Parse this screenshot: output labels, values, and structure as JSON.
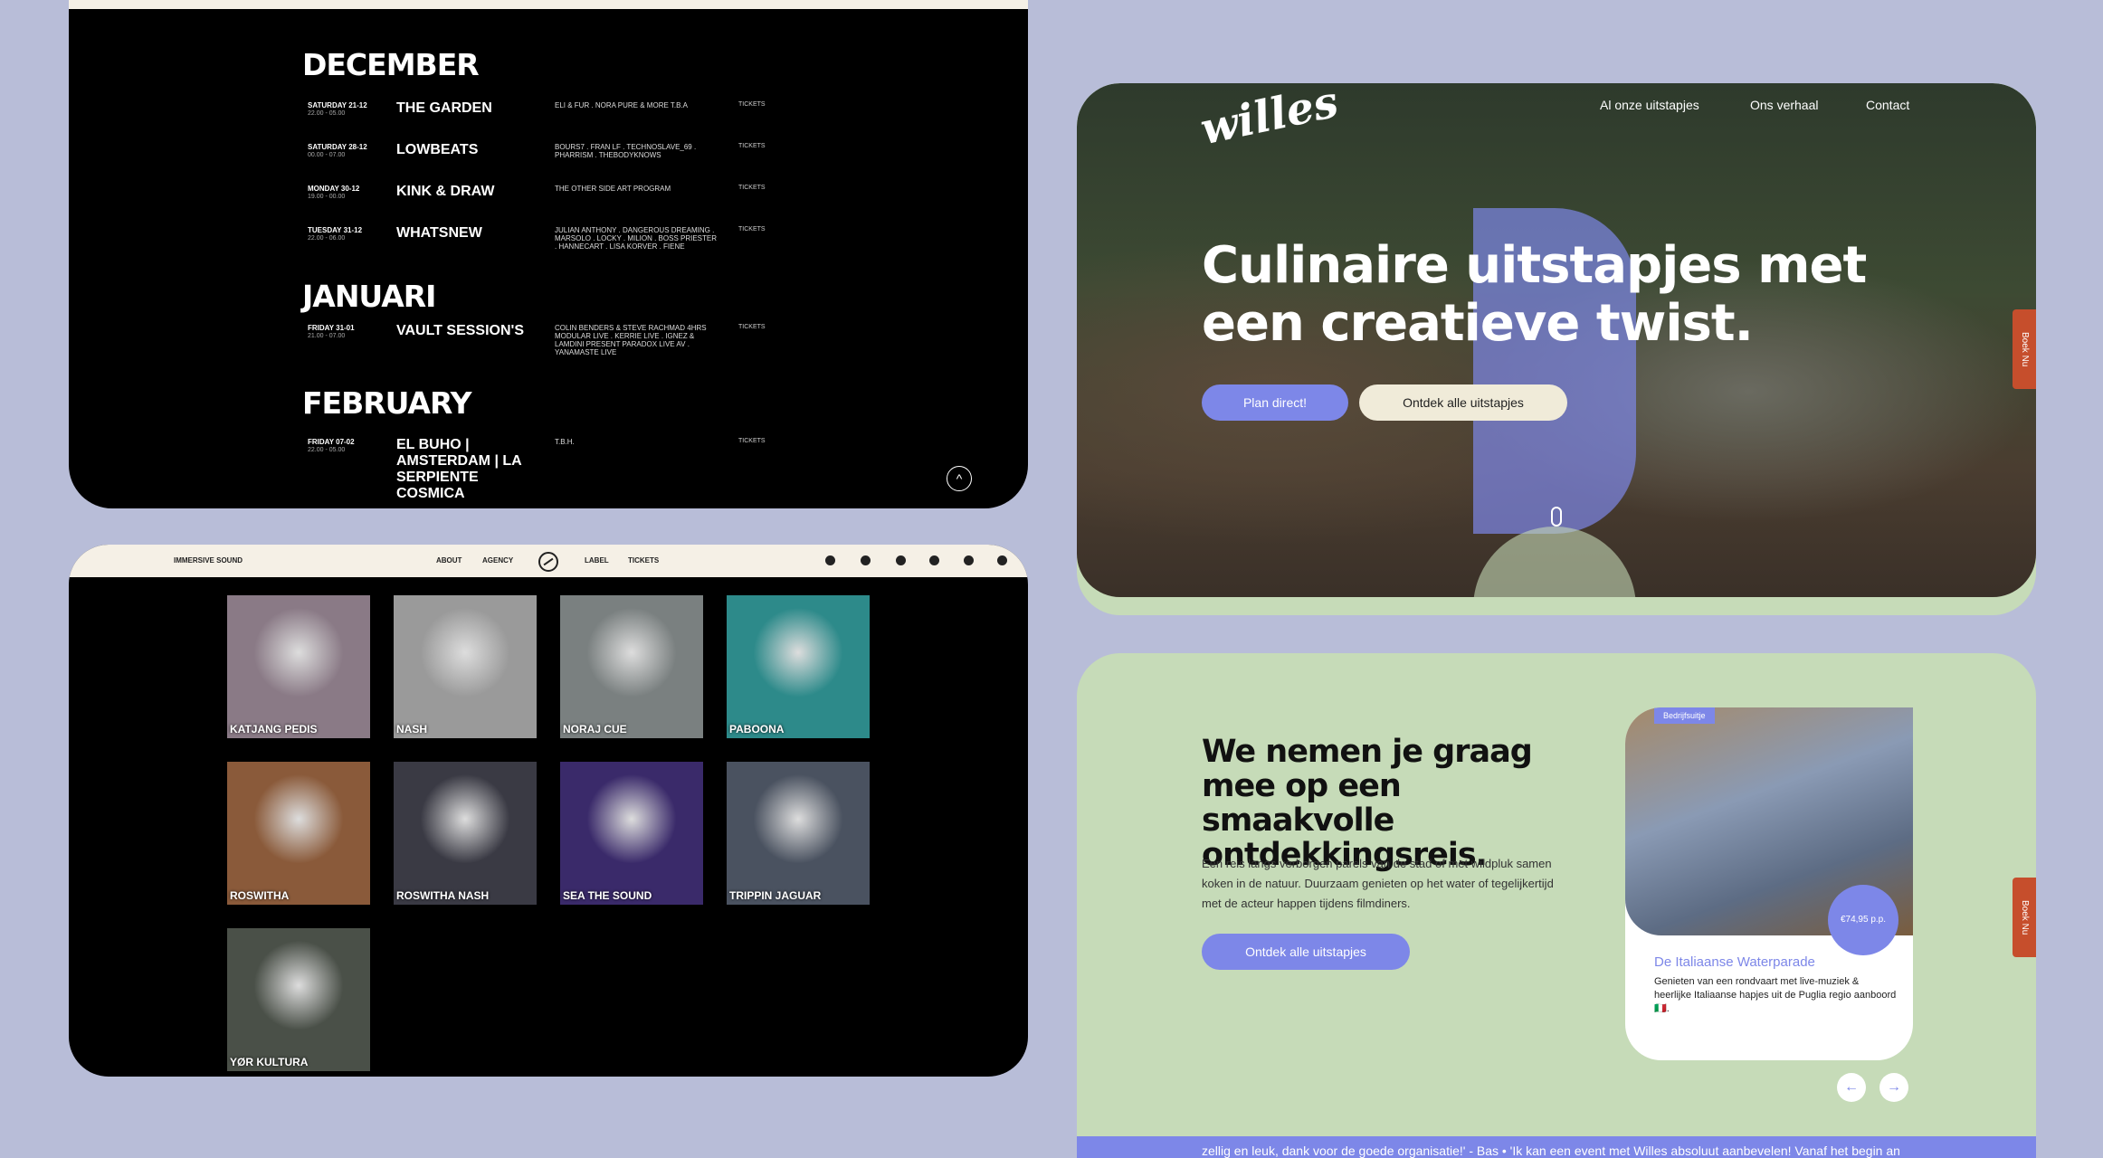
{
  "events": {
    "months": [
      {
        "name": "DECEMBER",
        "events": [
          {
            "date": "SATURDAY 21-12",
            "time": "22.00 - 05.00",
            "title": "THE GARDEN",
            "lineup": "ELI & FUR . NORA PURE & MORE T.B.A",
            "tickets": "TICKETS"
          },
          {
            "date": "SATURDAY 28-12",
            "time": "00.00 - 07.00",
            "title": "LOWBEATS",
            "lineup": "BOURS7 . FRAN LF . TECHNOSLAVE_69 . PHARRISM . THEBODYKNOWS",
            "tickets": "TICKETS"
          },
          {
            "date": "MONDAY 30-12",
            "time": "19.00 - 00.00",
            "title": "KINK & DRAW",
            "lineup": "THE OTHER SIDE ART PROGRAM",
            "tickets": "TICKETS"
          },
          {
            "date": "TUESDAY 31-12",
            "time": "22.00 - 06.00",
            "title": "WHATSNEW",
            "lineup": "JULIAN ANTHONY . DANGEROUS DREAMING . MARSOLO . LOCKY . MILION . BOSS PRIESTER . HANNECART . LISA KORVER . FIENE",
            "tickets": "TICKETS"
          }
        ]
      },
      {
        "name": "JANUARI",
        "events": [
          {
            "date": "FRIDAY 31-01",
            "time": "21.00 - 07.00",
            "title": "VAULT SESSION'S",
            "lineup": "COLIN BENDERS & STEVE RACHMAD 4HRS MODULAR LIVE . KERRIE LIVE . IGNEZ & LAMDINI PRESENT PARADOX LIVE AV . YANAMASTE LIVE",
            "tickets": "TICKETS"
          }
        ]
      },
      {
        "name": "FEBRUARY",
        "events": [
          {
            "date": "FRIDAY 07-02",
            "time": "22.00 - 05.00",
            "title": "EL BUHO | AMSTERDAM | LA SERPIENTE COSMICA",
            "lineup": "T.B.H.",
            "tickets": "TICKETS"
          }
        ]
      }
    ],
    "scroll_up_icon": "^"
  },
  "artists": {
    "brand": "IMMERSIVE SOUND",
    "nav": [
      "ABOUT",
      "AGENCY",
      "LABEL",
      "TICKETS"
    ],
    "social_icons": [
      "instagram-icon",
      "facebook-icon",
      "spotify-icon",
      "mixcloud-icon",
      "discogs-icon",
      "soundcloud-icon"
    ],
    "tiles": [
      {
        "name": "KATJANG PEDIS",
        "color": "#8a7a86"
      },
      {
        "name": "NASH",
        "color": "#9a9a9a"
      },
      {
        "name": "NORAJ CUE",
        "color": "#7a8080"
      },
      {
        "name": "PABOONA",
        "color": "#2d8a8a"
      },
      {
        "name": "ROSWITHA",
        "color": "#8a5a3a"
      },
      {
        "name": "ROSWITHA NASH",
        "color": "#3a3a44"
      },
      {
        "name": "SEA THE SOUND",
        "color": "#3a2a6a"
      },
      {
        "name": "TRIPPIN JAGUAR",
        "color": "#4a5260"
      },
      {
        "name": "YØR KULTURA",
        "color": "#4a5048"
      }
    ]
  },
  "hero": {
    "logo": "willes",
    "nav": [
      "Al onze uitstapjes",
      "Ons verhaal",
      "Contact"
    ],
    "title": "Culinaire uitstapjes met een creatieve twist.",
    "btn_plan": "Plan direct!",
    "btn_discover": "Ontdek alle uitstapjes",
    "boek_nu": "Boek Nu"
  },
  "promo": {
    "title": "We nemen je graag mee op een smaakvolle ontdekkingsreis.",
    "text": "Een reis langs verborgen parels van de stad of met wildpluk samen koken in de natuur. Duurzaam genieten op het water of tegelijkertijd met de acteur happen tijdens filmdiners.",
    "button": "Ontdek alle uitstapjes",
    "card": {
      "badge": "Bedrijfsuitje",
      "price": "€74,95 p.p.",
      "title": "De Italiaanse Waterparade",
      "desc": "Genieten van een rondvaart met live-muziek & heerlijke Italiaanse hapjes uit de Puglia regio aanboord 🇮🇹."
    },
    "prev_icon": "←",
    "next_icon": "→",
    "marquee": "zellig en leuk, dank voor de goede organisatie!' - Bas • 'Ik kan een event met Willes absoluut aanbevelen! Vanaf het begin an",
    "boek_nu": "Boek Nu"
  },
  "colors": {
    "accent": "#7d87e8",
    "sage": "#c6dbb8",
    "cream": "#f5f0e6",
    "orange": "#c64e2c"
  }
}
